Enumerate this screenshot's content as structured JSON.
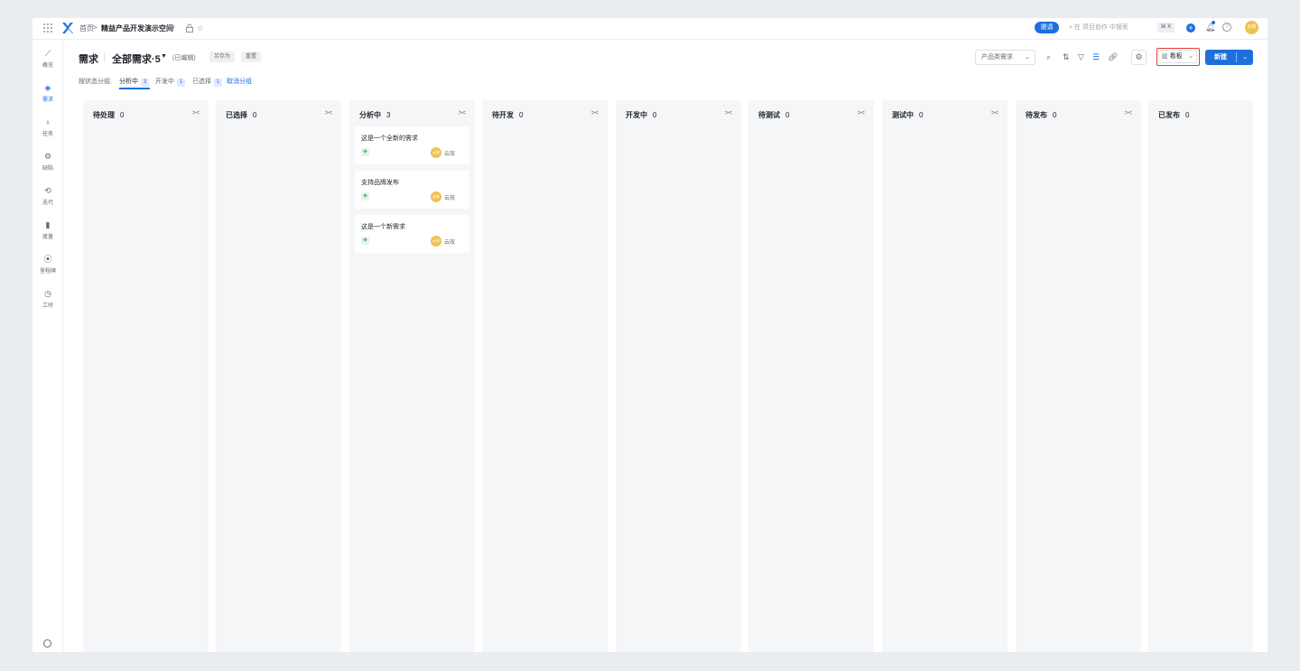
{
  "topbar": {
    "breadcrumb_home": "首页",
    "breadcrumb_sep": ">",
    "workspace": "精益产品开发演示空间",
    "invite_label": "邀请",
    "search_placeholder": "在 项目协作 中搜索",
    "shortcut": "⌘ K",
    "avatar_text": "云效"
  },
  "sidebar": {
    "items": [
      {
        "label": "概览",
        "icon": "chart-line-icon"
      },
      {
        "label": "需求",
        "icon": "layers-icon"
      },
      {
        "label": "任务",
        "icon": "bulb-icon"
      },
      {
        "label": "缺陷",
        "icon": "bug-icon"
      },
      {
        "label": "迭代",
        "icon": "iteration-icon"
      },
      {
        "label": "度量",
        "icon": "bar-chart-icon"
      },
      {
        "label": "里程碑",
        "icon": "pin-icon"
      },
      {
        "label": "工时",
        "icon": "timer-icon"
      }
    ]
  },
  "header": {
    "title": "需求",
    "view_name": "全部需求·5",
    "edited": "(已编辑)",
    "save_as": "另存为",
    "reset": "重置",
    "type_select": "产品类需求",
    "board_label": "看板",
    "new_label": "新建"
  },
  "group": {
    "label": "按状态分组:",
    "tabs": [
      {
        "label": "分析中",
        "count": "3"
      },
      {
        "label": "开发中",
        "count": "1"
      },
      {
        "label": "已选择",
        "count": "1"
      }
    ],
    "cancel": "取消分组"
  },
  "columns": [
    {
      "name": "待处理",
      "count": "0",
      "cards": []
    },
    {
      "name": "已选择",
      "count": "0",
      "cards": []
    },
    {
      "name": "分析中",
      "count": "3",
      "cards": [
        {
          "title": "这是一个全新的需求",
          "avatar": "云效",
          "owner": "云效"
        },
        {
          "title": "支持品牌发布",
          "avatar": "云效",
          "owner": "云效"
        },
        {
          "title": "这是一个新需求",
          "avatar": "云效",
          "owner": "云效"
        }
      ]
    },
    {
      "name": "待开发",
      "count": "0",
      "cards": []
    },
    {
      "name": "开发中",
      "count": "0",
      "cards": []
    },
    {
      "name": "待测试",
      "count": "0",
      "cards": []
    },
    {
      "name": "测试中",
      "count": "0",
      "cards": []
    },
    {
      "name": "待发布",
      "count": "0",
      "cards": []
    },
    {
      "name": "已发布",
      "count": "0",
      "cards": []
    }
  ],
  "colors": {
    "accent": "#1e6fde",
    "highlight_border": "#e03c31",
    "avatar": "#f0c24b"
  }
}
